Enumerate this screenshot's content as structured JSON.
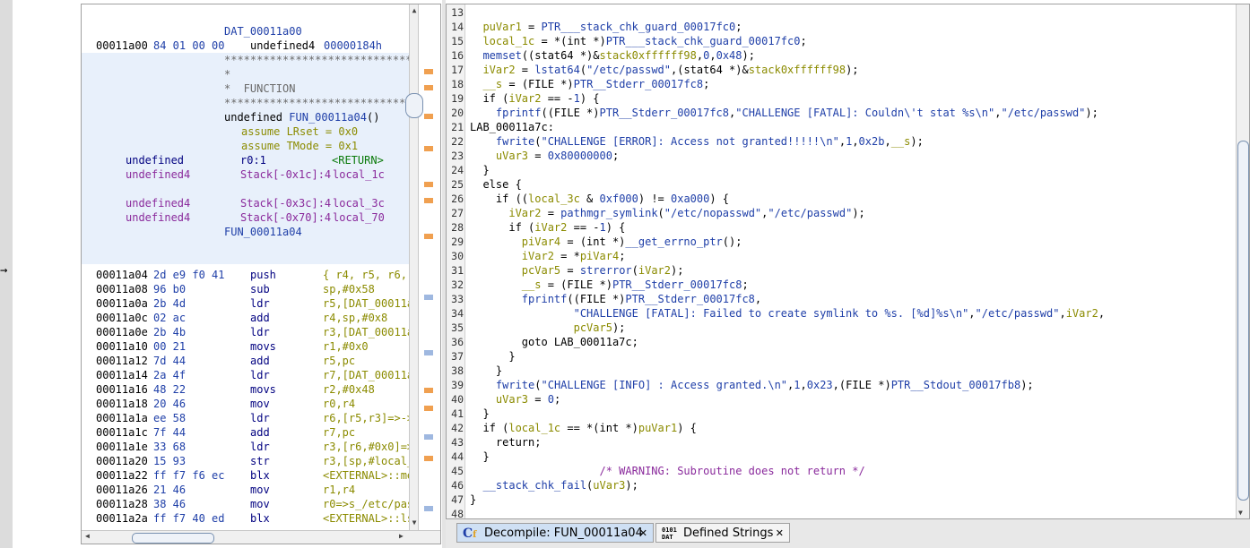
{
  "listing": {
    "header_label": "DAT_00011a00",
    "data_row": {
      "addr": "00011a00",
      "bytes": "84 01 00 00",
      "type": "undefined4",
      "value": "00000184h"
    },
    "banner": [
      "************************************",
      "*",
      "*  FUNCTION",
      "************************************"
    ],
    "signature": {
      "ret": "undefined",
      "name": "FUN_00011a04",
      "tail": "()"
    },
    "assumes": [
      "assume LRset = 0x0",
      "assume TMode = 0x1"
    ],
    "vars": [
      {
        "type": "undefined",
        "loc": "r0:1",
        "name": "<RETURN>"
      },
      {
        "type": "undefined4",
        "loc": "Stack[-0x1c]:4",
        "name": "local_1c"
      },
      {
        "type": "undefined4",
        "loc": "Stack[-0x3c]:4",
        "name": "local_3c"
      },
      {
        "type": "undefined4",
        "loc": "Stack[-0x70]:4",
        "name": "local_70"
      }
    ],
    "fn_label": "FUN_00011a04",
    "instructions": [
      {
        "addr": "00011a04",
        "bytes": "2d e9 f0 41",
        "mnem": "push",
        "ops": "{ r4, r5, r6,"
      },
      {
        "addr": "00011a08",
        "bytes": "96 b0",
        "mnem": "sub",
        "ops": "sp,#0x58"
      },
      {
        "addr": "00011a0a",
        "bytes": "2b 4d",
        "mnem": "ldr",
        "ops": "r5,[DAT_00011a"
      },
      {
        "addr": "00011a0c",
        "bytes": "02 ac",
        "mnem": "add",
        "ops": "r4,sp,#0x8"
      },
      {
        "addr": "00011a0e",
        "bytes": "2b 4b",
        "mnem": "ldr",
        "ops": "r3,[DAT_00011a"
      },
      {
        "addr": "00011a10",
        "bytes": "00 21",
        "mnem": "movs",
        "ops": "r1,#0x0"
      },
      {
        "addr": "00011a12",
        "bytes": "7d 44",
        "mnem": "add",
        "ops": "r5,pc"
      },
      {
        "addr": "00011a14",
        "bytes": "2a 4f",
        "mnem": "ldr",
        "ops": "r7,[DAT_00011a"
      },
      {
        "addr": "00011a16",
        "bytes": "48 22",
        "mnem": "movs",
        "ops": "r2,#0x48"
      },
      {
        "addr": "00011a18",
        "bytes": "20 46",
        "mnem": "mov",
        "ops": "r0,r4"
      },
      {
        "addr": "00011a1a",
        "bytes": "ee 58",
        "mnem": "ldr",
        "ops": "r6,[r5,r3]=>->"
      },
      {
        "addr": "00011a1c",
        "bytes": "7f 44",
        "mnem": "add",
        "ops": "r7,pc"
      },
      {
        "addr": "00011a1e",
        "bytes": "33 68",
        "mnem": "ldr",
        "ops": "r3,[r6,#0x0]=>"
      },
      {
        "addr": "00011a20",
        "bytes": "15 93",
        "mnem": "str",
        "ops": "r3,[sp,#local_"
      },
      {
        "addr": "00011a22",
        "bytes": "ff f7 f6 ec",
        "mnem": "blx",
        "ops": "<EXTERNAL>::me"
      },
      {
        "addr": "00011a26",
        "bytes": "21 46",
        "mnem": "mov",
        "ops": "r1,r4"
      },
      {
        "addr": "00011a28",
        "bytes": "38 46",
        "mnem": "mov",
        "ops": "r0=>s_/etc/pas"
      },
      {
        "addr": "00011a2a",
        "bytes": "ff f7 40 ed",
        "mnem": "blx",
        "ops": "<EXTERNAL>::ls"
      }
    ]
  },
  "decompile": {
    "lines": [
      {
        "n": "13",
        "t": ""
      },
      {
        "n": "14",
        "t": "  puVar1 = PTR___stack_chk_guard_00017fc0;"
      },
      {
        "n": "15",
        "t": "  local_1c = *(int *)PTR___stack_chk_guard_00017fc0;"
      },
      {
        "n": "16",
        "t": "  memset((stat64 *)&stack0xffffff98,0,0x48);"
      },
      {
        "n": "17",
        "t": "  iVar2 = lstat64(\"/etc/passwd\",(stat64 *)&stack0xffffff98);"
      },
      {
        "n": "18",
        "t": "  __s = (FILE *)PTR__Stderr_00017fc8;"
      },
      {
        "n": "19",
        "t": "  if (iVar2 == -1) {"
      },
      {
        "n": "20",
        "t": "    fprintf((FILE *)PTR__Stderr_00017fc8,\"CHALLENGE [FATAL]: Couldn\\'t stat %s\\n\",\"/etc/passwd\");"
      },
      {
        "n": "21",
        "t": "LAB_00011a7c:"
      },
      {
        "n": "22",
        "t": "    fwrite(\"CHALLENGE [ERROR]: Access not granted!!!!!\\n\",1,0x2b,__s);"
      },
      {
        "n": "23",
        "t": "    uVar3 = 0x80000000;"
      },
      {
        "n": "24",
        "t": "  }"
      },
      {
        "n": "25",
        "t": "  else {"
      },
      {
        "n": "26",
        "t": "    if ((local_3c & 0xf000) != 0xa000) {"
      },
      {
        "n": "27",
        "t": "      iVar2 = pathmgr_symlink(\"/etc/nopasswd\",\"/etc/passwd\");"
      },
      {
        "n": "28",
        "t": "      if (iVar2 == -1) {"
      },
      {
        "n": "29",
        "t": "        piVar4 = (int *)__get_errno_ptr();"
      },
      {
        "n": "30",
        "t": "        iVar2 = *piVar4;"
      },
      {
        "n": "31",
        "t": "        pcVar5 = strerror(iVar2);"
      },
      {
        "n": "32",
        "t": "        __s = (FILE *)PTR__Stderr_00017fc8;"
      },
      {
        "n": "33",
        "t": "        fprintf((FILE *)PTR__Stderr_00017fc8,"
      },
      {
        "n": "34",
        "t": "                \"CHALLENGE [FATAL]: Failed to create symlink to %s. [%d]%s\\n\",\"/etc/passwd\",iVar2,"
      },
      {
        "n": "35",
        "t": "                pcVar5);"
      },
      {
        "n": "36",
        "t": "        goto LAB_00011a7c;"
      },
      {
        "n": "37",
        "t": "      }"
      },
      {
        "n": "38",
        "t": "    }"
      },
      {
        "n": "39",
        "t": "    fwrite(\"CHALLENGE [INFO] : Access granted.\\n\",1,0x23,(FILE *)PTR__Stdout_00017fb8);"
      },
      {
        "n": "40",
        "t": "    uVar3 = 0;"
      },
      {
        "n": "41",
        "t": "  }"
      },
      {
        "n": "42",
        "t": "  if (local_1c == *(int *)puVar1) {"
      },
      {
        "n": "43",
        "t": "    return;"
      },
      {
        "n": "44",
        "t": "  }"
      },
      {
        "n": "45",
        "t": "                    /* WARNING: Subroutine does not return */"
      },
      {
        "n": "46",
        "t": "  __stack_chk_fail(uVar3);"
      },
      {
        "n": "47",
        "t": "}"
      },
      {
        "n": "48",
        "t": ""
      }
    ]
  },
  "tabs": [
    {
      "label": "Decompile: FUN_00011a04",
      "icon": "decompile-icon",
      "active": true
    },
    {
      "label": "Defined Strings",
      "icon": "defined-strings-icon",
      "icon_text": "0101\nDAT",
      "active": false
    }
  ],
  "colors": {
    "accent": "#1f3fa8",
    "variable": "#8b8b00",
    "comment": "#8a2a9c",
    "selection": "#e8f0fb",
    "tab_active": "#cfe0f4"
  }
}
